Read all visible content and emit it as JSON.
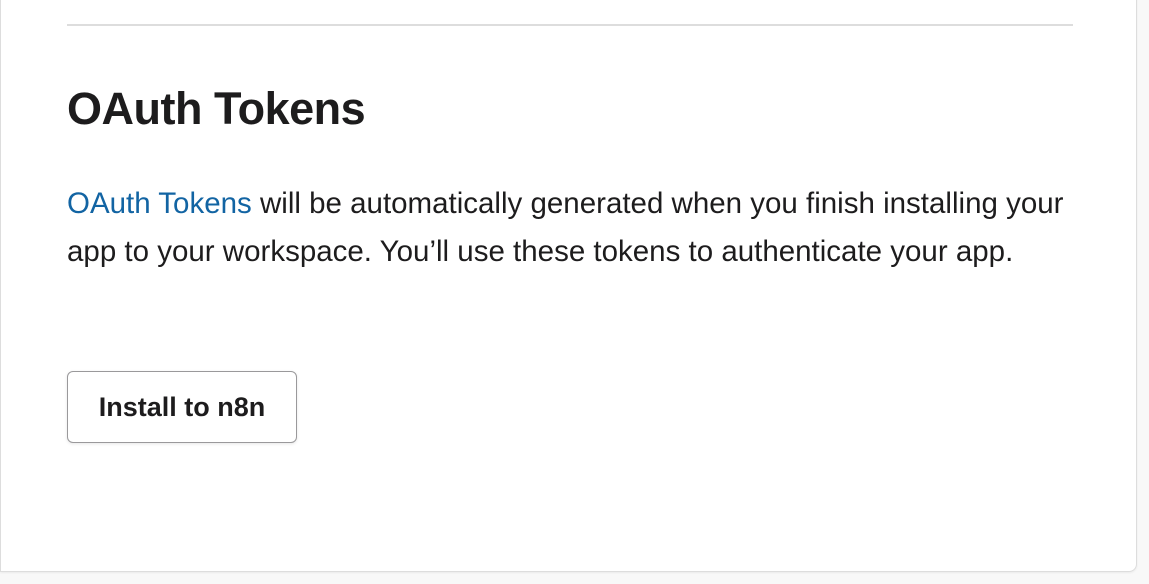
{
  "section": {
    "title": "OAuth Tokens",
    "description_link": "OAuth Tokens",
    "description_text": " will be automatically generated when you finish installing your app to your workspace. You’ll use these tokens to authenticate your app."
  },
  "actions": {
    "install_label": "Install to n8n"
  },
  "colors": {
    "link": "#1264a3",
    "text": "#1d1c1d",
    "divider": "#dddddd",
    "background": "#f8f8f8"
  }
}
